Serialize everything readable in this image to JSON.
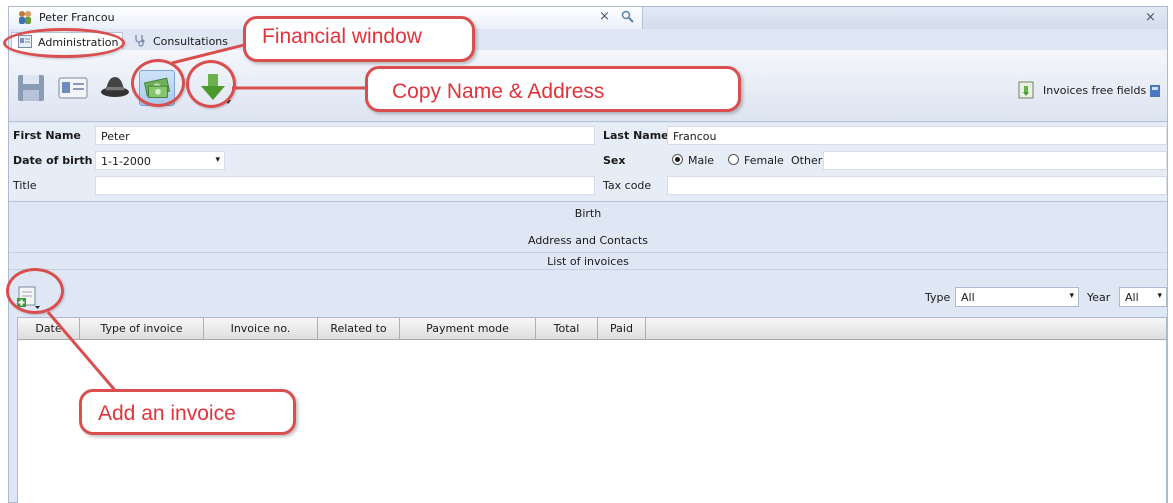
{
  "window": {
    "doc_tab_title": "Peter Francou",
    "doc_tab_close": "×",
    "search_tab_close": "×"
  },
  "subtabs": [
    {
      "label": "Administration"
    },
    {
      "label": "Consultations"
    }
  ],
  "toolbar": {
    "invoices_free_fields": "Invoices free fields"
  },
  "form": {
    "first_name_label": "First Name",
    "first_name_value": "Peter",
    "last_name_label": "Last Name",
    "last_name_value": "Francou",
    "dob_label": "Date of birth",
    "dob_value": "1-1-2000",
    "dob_arrow": "▾",
    "sex_label": "Sex",
    "sex_options": [
      "Male",
      "Female",
      "Other"
    ],
    "sex_selected": "Male",
    "other_value": "",
    "title_label": "Title",
    "title_value": "",
    "tax_code_label": "Tax code",
    "tax_code_value": ""
  },
  "sections": {
    "birth": "Birth",
    "address": "Address and Contacts",
    "invoices": "List of invoices"
  },
  "filters": {
    "type_label": "Type",
    "type_value": "All",
    "year_label": "Year",
    "year_value": "All",
    "arrow": "▾"
  },
  "table": {
    "columns": [
      "Date",
      "Type of invoice",
      "Invoice no.",
      "Related to",
      "Payment mode",
      "Total",
      "Paid"
    ],
    "rows": []
  },
  "callouts": {
    "financial_window": "Financial window",
    "copy_name_address": "Copy Name & Address",
    "add_invoice": "Add an invoice"
  },
  "colors": {
    "callout_border": "#d94f4f",
    "callout_text": "#e0333a",
    "toolbar_pressed": "#a9c8ee"
  }
}
